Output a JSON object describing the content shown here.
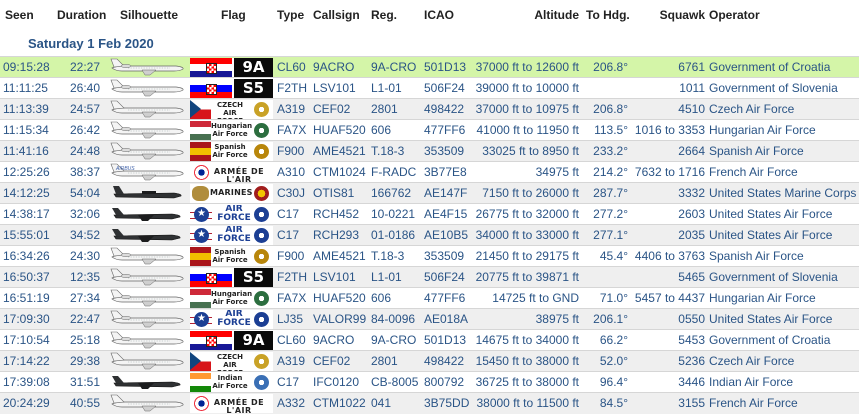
{
  "columns": {
    "seen": "Seen",
    "duration": "Duration",
    "silhouette": "Silhouette",
    "flag": "Flag",
    "type": "Type",
    "callsign": "Callsign",
    "reg": "Reg.",
    "icao": "ICAO",
    "altitude": "Altitude",
    "to_hdg": "To Hdg.",
    "squawk": "Squawk",
    "operator": "Operator"
  },
  "date_heading": "Saturday 1 Feb 2020",
  "colors": {
    "link": "#2a5486",
    "highlight_row": "#d4f5a8",
    "alt_row": "#efefef"
  },
  "rows": [
    {
      "seen": "09:15:28",
      "duration": "22:27",
      "type": "CL60",
      "callsign": "9ACRO",
      "reg": "9A-CRO",
      "icao": "501D13",
      "altitude": "37000 ft to 12600 ft",
      "hdg": "206.8°",
      "squawk": "6761",
      "operator": "Government of Croatia",
      "flag": {
        "kind": "code",
        "code": "9A",
        "country": "croatia"
      },
      "silhouette": "bizjet"
    },
    {
      "seen": "11:11:25",
      "duration": "26:40",
      "type": "F2TH",
      "callsign": "LSV101",
      "reg": "L1-01",
      "icao": "506F24",
      "altitude": "39000 ft to 10000 ft",
      "hdg": "",
      "squawk": "1011",
      "operator": "Government of Slovenia",
      "flag": {
        "kind": "code",
        "code": "S5",
        "country": "slovenia"
      },
      "silhouette": "trijet"
    },
    {
      "seen": "11:13:39",
      "duration": "24:57",
      "type": "A319",
      "callsign": "CEF02",
      "reg": "2801",
      "icao": "498422",
      "altitude": "37000 ft to 10975 ft",
      "hdg": "206.8°",
      "squawk": "4510",
      "operator": "Czech Air Force",
      "flag": {
        "kind": "text",
        "lines": [
          "CZECH",
          "AIR FORCE"
        ],
        "country": "czech"
      },
      "silhouette": "airliner"
    },
    {
      "seen": "11:15:34",
      "duration": "26:42",
      "type": "FA7X",
      "callsign": "HUAF520",
      "reg": "606",
      "icao": "477FF6",
      "altitude": "41000 ft to 11950 ft",
      "hdg": "113.5°",
      "squawk": "1016 to 3353",
      "operator": "Hungarian Air Force",
      "flag": {
        "kind": "text",
        "lines": [
          "Hungarian",
          "Air Force"
        ],
        "country": "hungary"
      },
      "silhouette": "trijet"
    },
    {
      "seen": "11:41:16",
      "duration": "24:48",
      "type": "F900",
      "callsign": "AME4521",
      "reg": "T.18-3",
      "icao": "353509",
      "altitude": "33025 ft to 8950 ft",
      "hdg": "233.2°",
      "squawk": "2664",
      "operator": "Spanish Air Force",
      "flag": {
        "kind": "text",
        "lines": [
          "Spanish",
          "Air Force"
        ],
        "country": "spain"
      },
      "silhouette": "trijet"
    },
    {
      "seen": "12:25:26",
      "duration": "38:37",
      "type": "A310",
      "callsign": "CTM1024",
      "reg": "F-RADC",
      "icao": "3B77E8",
      "altitude": "34975 ft",
      "hdg": "214.2°",
      "squawk": "7632 to 1716",
      "operator": "French Air Force",
      "flag": {
        "kind": "one",
        "text": "ARMÉE DE L'AIR",
        "country": "france"
      },
      "silhouette": "airbus",
      "sil_label": "AIRBUS"
    },
    {
      "seen": "14:12:25",
      "duration": "54:04",
      "type": "C30J",
      "callsign": "OTIS81",
      "reg": "166762",
      "icao": "AE147F",
      "altitude": "7150 ft to 26000 ft",
      "hdg": "287.7°",
      "squawk": "3332",
      "operator": "United States Marine Corps",
      "flag": {
        "kind": "one",
        "text": "MARINES",
        "country": "usmc"
      },
      "silhouette": "herc"
    },
    {
      "seen": "14:38:17",
      "duration": "32:06",
      "type": "C17",
      "callsign": "RCH452",
      "reg": "10-0221",
      "icao": "AE4F15",
      "altitude": "26775 ft to 32000 ft",
      "hdg": "277.2°",
      "squawk": "2603",
      "operator": "United States Air Force",
      "flag": {
        "kind": "text",
        "lines": [
          "AIR",
          "FORCE"
        ],
        "country": "usaf",
        "big": true
      },
      "silhouette": "c17"
    },
    {
      "seen": "15:55:01",
      "duration": "34:52",
      "type": "C17",
      "callsign": "RCH293",
      "reg": "01-0186",
      "icao": "AE10B5",
      "altitude": "34000 ft to 33000 ft",
      "hdg": "277.1°",
      "squawk": "2035",
      "operator": "United States Air Force",
      "flag": {
        "kind": "text",
        "lines": [
          "AIR",
          "FORCE"
        ],
        "country": "usaf",
        "big": true
      },
      "silhouette": "c17"
    },
    {
      "seen": "16:34:26",
      "duration": "24:30",
      "type": "F900",
      "callsign": "AME4521",
      "reg": "T.18-3",
      "icao": "353509",
      "altitude": "21450 ft to 29175 ft",
      "hdg": "45.4°",
      "squawk": "4406 to 3763",
      "operator": "Spanish Air Force",
      "flag": {
        "kind": "text",
        "lines": [
          "Spanish",
          "Air Force"
        ],
        "country": "spain"
      },
      "silhouette": "trijet"
    },
    {
      "seen": "16:50:37",
      "duration": "12:35",
      "type": "F2TH",
      "callsign": "LSV101",
      "reg": "L1-01",
      "icao": "506F24",
      "altitude": "20775 ft to 39871 ft",
      "hdg": "",
      "squawk": "5465",
      "operator": "Government of Slovenia",
      "flag": {
        "kind": "code",
        "code": "S5",
        "country": "slovenia"
      },
      "silhouette": "trijet"
    },
    {
      "seen": "16:51:19",
      "duration": "27:34",
      "type": "FA7X",
      "callsign": "HUAF520",
      "reg": "606",
      "icao": "477FF6",
      "altitude": "14725 ft to GND",
      "hdg": "71.0°",
      "squawk": "5457 to 4437",
      "operator": "Hungarian Air Force",
      "flag": {
        "kind": "text",
        "lines": [
          "Hungarian",
          "Air Force"
        ],
        "country": "hungary"
      },
      "silhouette": "trijet"
    },
    {
      "seen": "17:09:30",
      "duration": "22:47",
      "type": "LJ35",
      "callsign": "VALOR99",
      "reg": "84-0096",
      "icao": "AE018A",
      "altitude": "38975 ft",
      "hdg": "206.1°",
      "squawk": "0550",
      "operator": "United States Air Force",
      "flag": {
        "kind": "text",
        "lines": [
          "AIR",
          "FORCE"
        ],
        "country": "usaf",
        "big": true
      },
      "silhouette": "learjet"
    },
    {
      "seen": "17:10:54",
      "duration": "25:18",
      "type": "CL60",
      "callsign": "9ACRO",
      "reg": "9A-CRO",
      "icao": "501D13",
      "altitude": "14675 ft to 34000 ft",
      "hdg": "66.2°",
      "squawk": "5453",
      "operator": "Government of Croatia",
      "flag": {
        "kind": "code",
        "code": "9A",
        "country": "croatia"
      },
      "silhouette": "bizjet"
    },
    {
      "seen": "17:14:22",
      "duration": "29:38",
      "type": "A319",
      "callsign": "CEF02",
      "reg": "2801",
      "icao": "498422",
      "altitude": "15450 ft to 38000 ft",
      "hdg": "52.0°",
      "squawk": "5236",
      "operator": "Czech Air Force",
      "flag": {
        "kind": "text",
        "lines": [
          "CZECH",
          "AIR FORCE"
        ],
        "country": "czech"
      },
      "silhouette": "airliner"
    },
    {
      "seen": "17:39:08",
      "duration": "31:51",
      "type": "C17",
      "callsign": "IFC0120",
      "reg": "CB-8005",
      "icao": "800792",
      "altitude": "36725 ft to 38000 ft",
      "hdg": "96.4°",
      "squawk": "3446",
      "operator": "Indian Air Force",
      "flag": {
        "kind": "text",
        "lines": [
          "Indian",
          "Air Force"
        ],
        "country": "india"
      },
      "silhouette": "c17"
    },
    {
      "seen": "20:24:29",
      "duration": "40:55",
      "type": "A332",
      "callsign": "CTM1022",
      "reg": "041",
      "icao": "3B75DD",
      "altitude": "38000 ft to 11500 ft",
      "hdg": "84.5°",
      "squawk": "3155",
      "operator": "French Air Force",
      "flag": {
        "kind": "one",
        "text": "ARMÉE DE L'AIR",
        "country": "france"
      },
      "silhouette": "airliner"
    }
  ]
}
